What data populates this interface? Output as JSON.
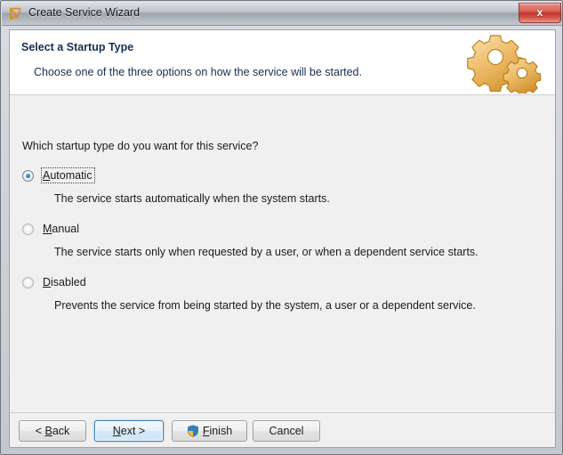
{
  "window": {
    "title": "Create Service Wizard",
    "icon": "wizard-drafting-icon",
    "close_label": "x",
    "frame_color": "#cfd4da"
  },
  "header": {
    "title": "Select a Startup Type",
    "subtitle": "Choose one of the three options on how the service will be started.",
    "graphic": "gears-icon"
  },
  "main": {
    "question": "Which startup type do you want for this service?",
    "options": [
      {
        "id": "automatic",
        "label": "Automatic",
        "mnemonic": "A",
        "selected": true,
        "focused": true,
        "description": "The service starts automatically when the system starts."
      },
      {
        "id": "manual",
        "label": "Manual",
        "mnemonic": "M",
        "selected": false,
        "focused": false,
        "description": "The service starts only when requested by a user, or when a dependent service starts."
      },
      {
        "id": "disabled",
        "label": "Disabled",
        "mnemonic": "D",
        "selected": false,
        "focused": false,
        "description": "Prevents the service from being started by the system, a user or a dependent service."
      }
    ]
  },
  "footer": {
    "buttons": [
      {
        "id": "back",
        "label": "< Back",
        "mnemonic": "B",
        "default": false,
        "icon": null
      },
      {
        "id": "next",
        "label": "Next >",
        "mnemonic": "N",
        "default": true,
        "icon": null
      },
      {
        "id": "finish",
        "label": "Finish",
        "mnemonic": "F",
        "default": false,
        "icon": "uac-shield-icon"
      },
      {
        "id": "cancel",
        "label": "Cancel",
        "mnemonic": null,
        "default": false,
        "icon": null
      }
    ]
  },
  "colors": {
    "accent": "#3c7fb1",
    "header_text": "#14314f",
    "body_background": "#f0f0f0",
    "close_button": "#c2362c",
    "gear": "#e8a33d"
  }
}
